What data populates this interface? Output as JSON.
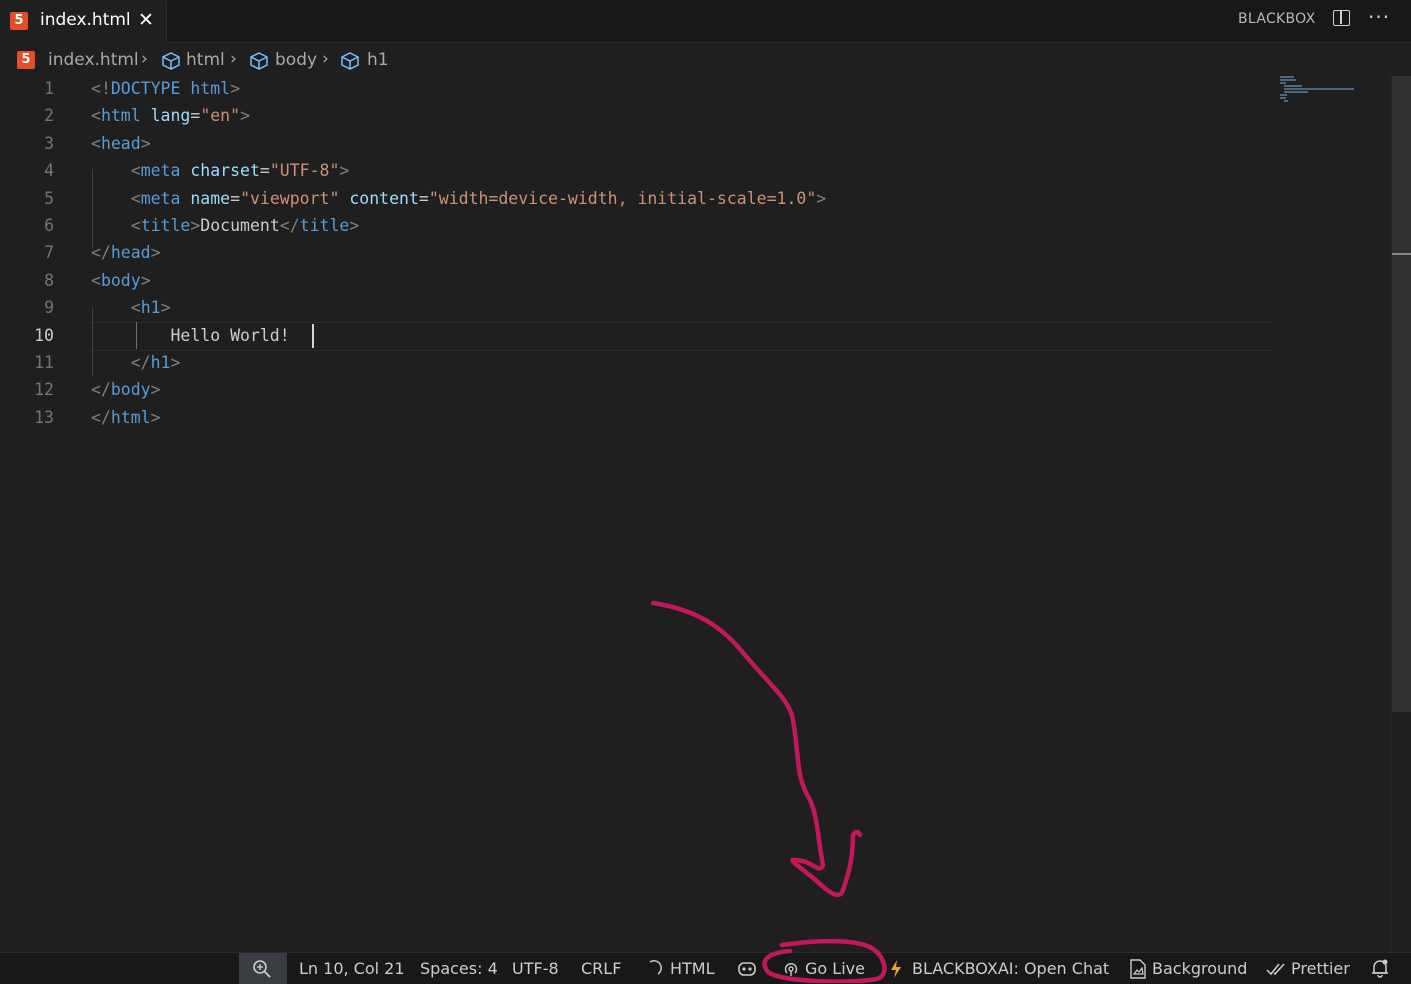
{
  "tab": {
    "filename": "index.html",
    "close_glyph": "✕"
  },
  "top_right": {
    "label": "BLACKBOX"
  },
  "breadcrumb": {
    "file": "index.html",
    "items": [
      "html",
      "body",
      "h1"
    ]
  },
  "editor": {
    "current_line": 10,
    "line_numbers": [
      "1",
      "2",
      "3",
      "4",
      "5",
      "6",
      "7",
      "8",
      "9",
      "10",
      "11",
      "12",
      "13"
    ],
    "lines": [
      "<!DOCTYPE html>",
      "<html lang=\"en\">",
      "<head>",
      "    <meta charset=\"UTF-8\">",
      "    <meta name=\"viewport\" content=\"width=device-width, initial-scale=1.0\">",
      "    <title>Document</title>",
      "</head>",
      "<body>",
      "    <h1>",
      "        Hello World!",
      "    </h1>",
      "</body>",
      "</html>"
    ]
  },
  "statusbar": {
    "position": "Ln 10, Col 21",
    "spaces": "Spaces: 4",
    "encoding": "UTF-8",
    "eol": "CRLF",
    "language": "HTML",
    "go_live": "Go Live",
    "blackbox_chat": "BLACKBOXAI: Open Chat",
    "background": "Background",
    "prettier": "Prettier"
  },
  "colors": {
    "annotation": "#c2185b",
    "tag": "#569cd6",
    "attribute": "#9cdcfe",
    "string": "#ce9178",
    "html5_badge": "#e44d26"
  }
}
